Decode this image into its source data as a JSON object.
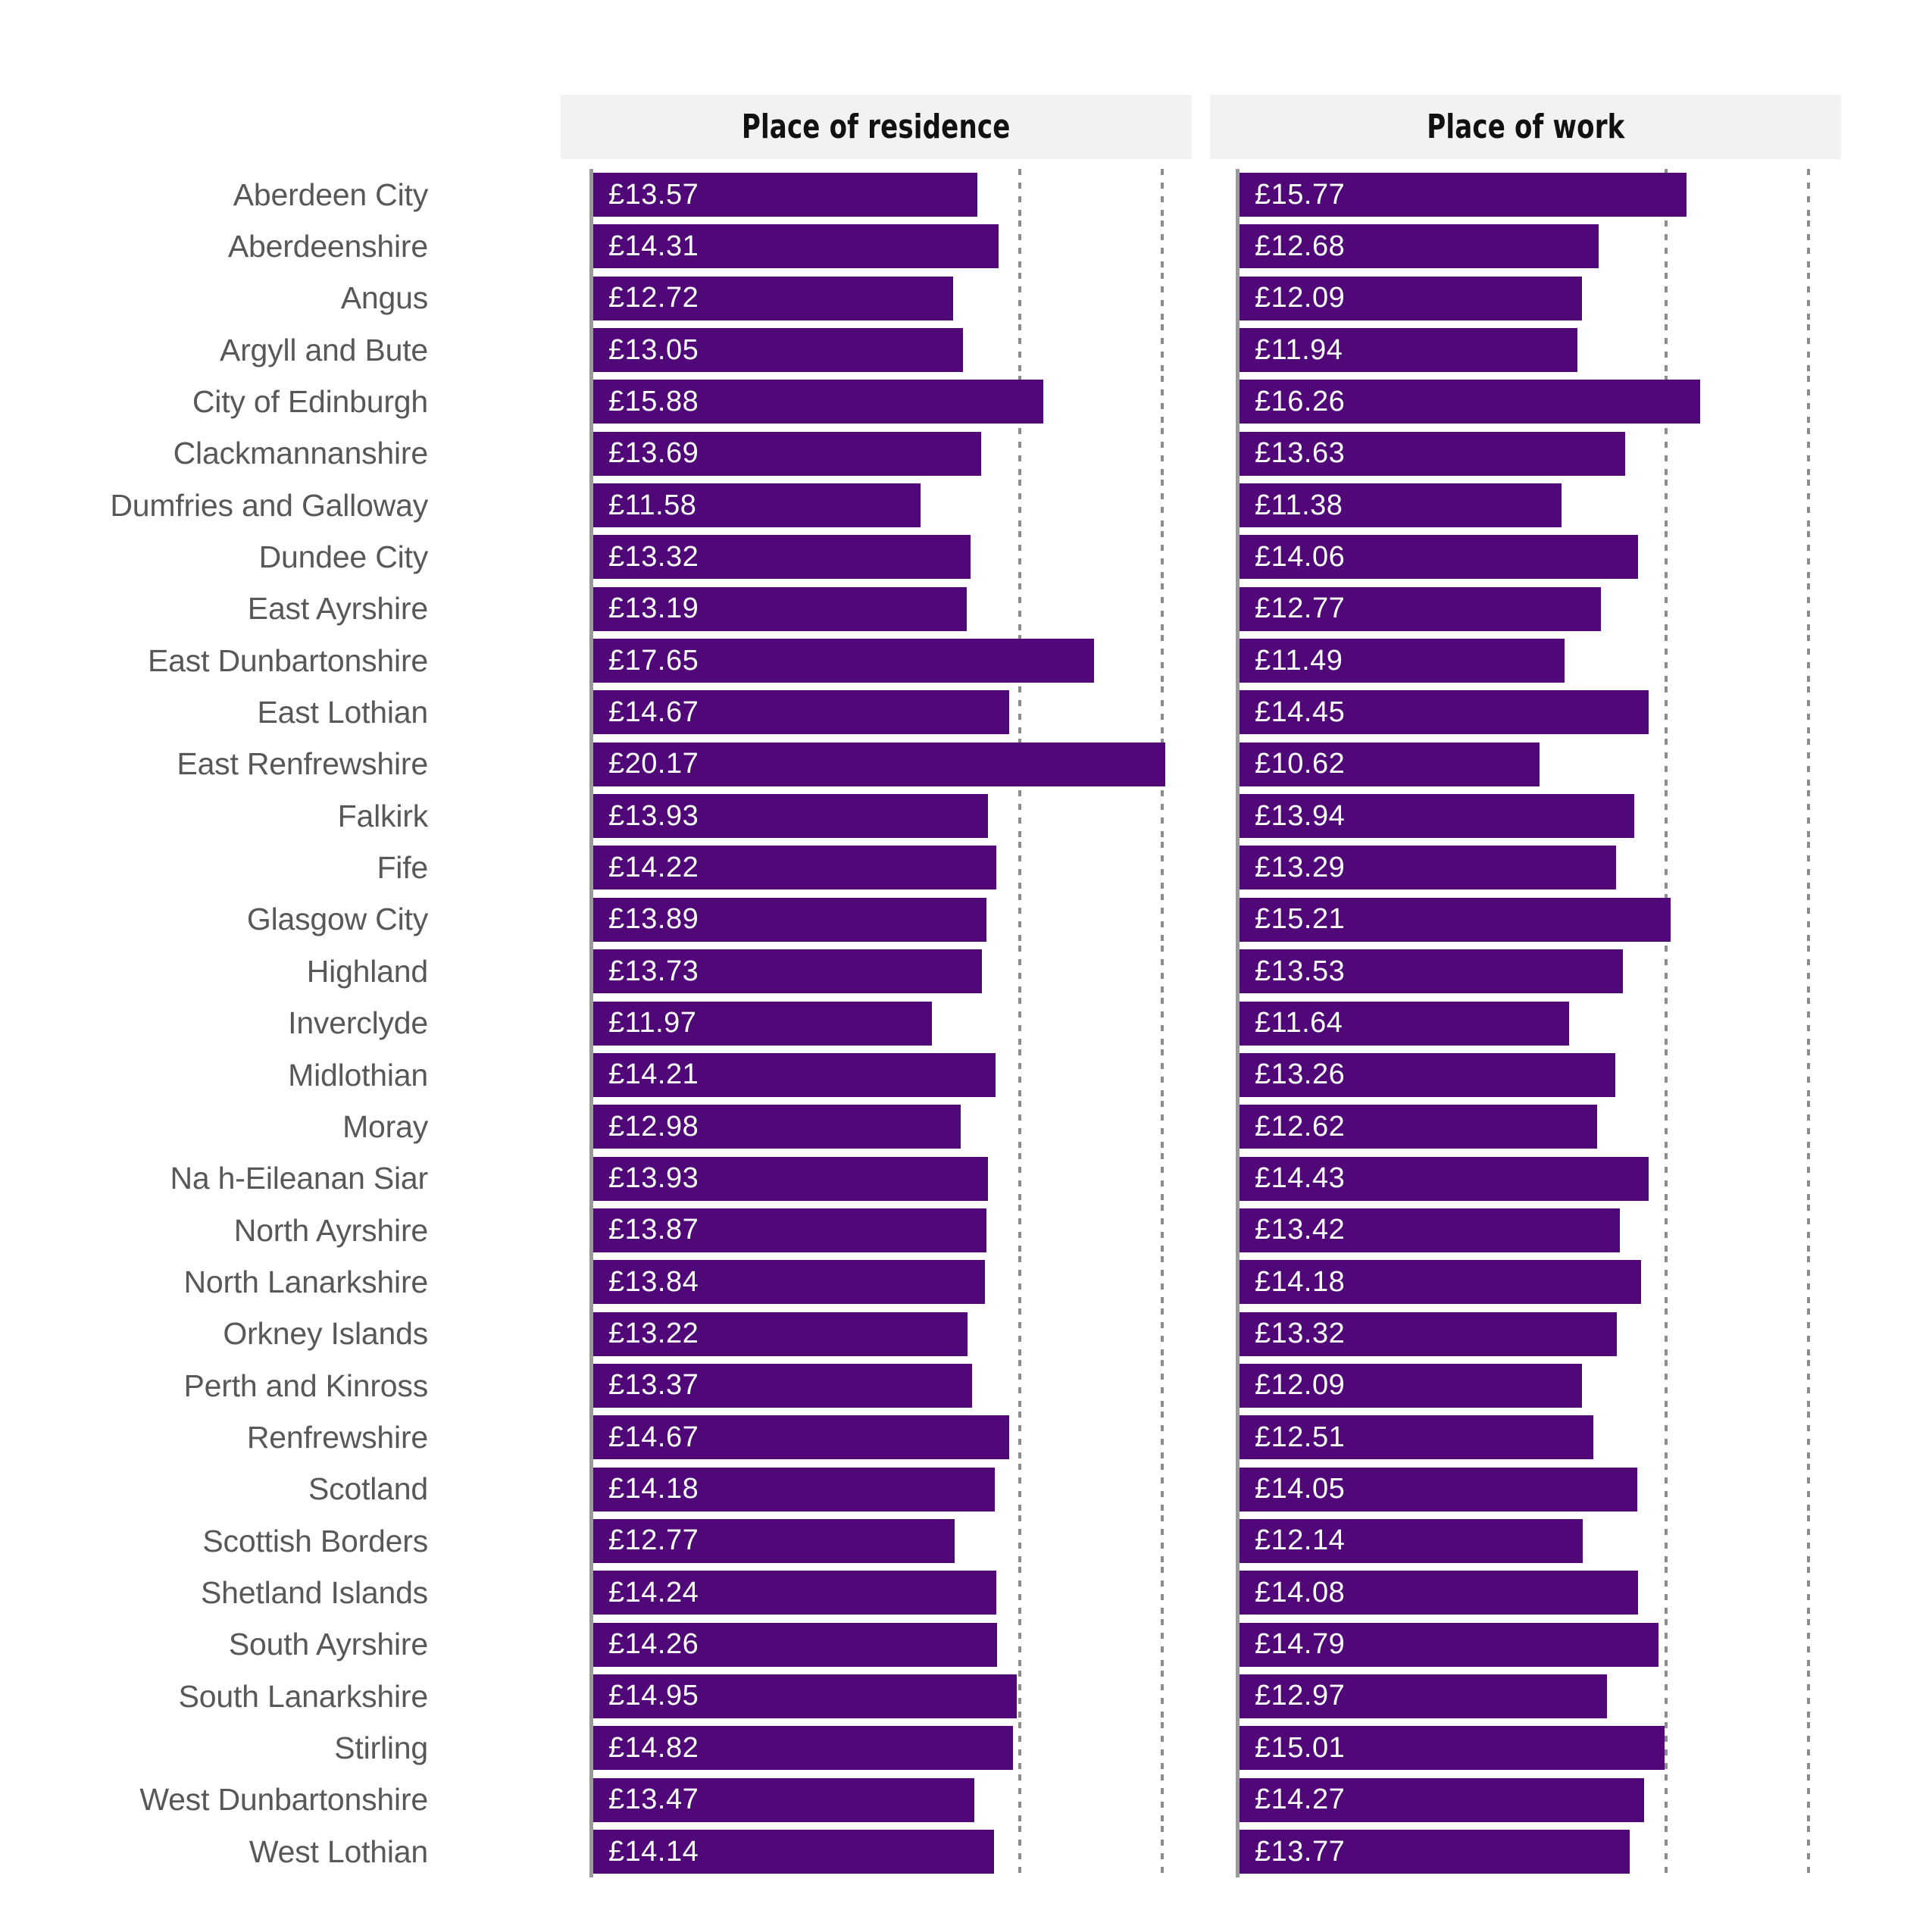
{
  "panels": [
    {
      "id": "residence",
      "title": "Place of residence"
    },
    {
      "id": "work",
      "title": "Place of work"
    }
  ],
  "colors": {
    "bar": "#500878",
    "header_band": "#f2f2f2",
    "label_text": "#58585b",
    "axis": "#9a9a9a",
    "grid": "#8c8c8c",
    "value_text": "#ffffff",
    "background": "#ffffff"
  },
  "chart_data": {
    "type": "bar",
    "title": "",
    "subtitle": "",
    "xlabel": "",
    "ylabel": "",
    "orientation": "horizontal",
    "grid": true,
    "grid_values": [
      15,
      20
    ],
    "legend": "none",
    "value_prefix": "£",
    "xlim": [
      0,
      22
    ],
    "categories": [
      "Aberdeen City",
      "Aberdeenshire",
      "Angus",
      "Argyll and Bute",
      "City of Edinburgh",
      "Clackmannanshire",
      "Dumfries and Galloway",
      "Dundee City",
      "East Ayrshire",
      "East Dunbartonshire",
      "East Lothian",
      "East Renfrewshire",
      "Falkirk",
      "Fife",
      "Glasgow City",
      "Highland",
      "Inverclyde",
      "Midlothian",
      "Moray",
      "Na h-Eileanan Siar",
      "North Ayrshire",
      "North Lanarkshire",
      "Orkney Islands",
      "Perth and Kinross",
      "Renfrewshire",
      "Scotland",
      "Scottish Borders",
      "Shetland Islands",
      "South Ayrshire",
      "South Lanarkshire",
      "Stirling",
      "West Dunbartonshire",
      "West Lothian"
    ],
    "series": [
      {
        "name": "Place of residence",
        "values": [
          13.57,
          14.31,
          12.72,
          13.05,
          15.88,
          13.69,
          11.58,
          13.32,
          13.19,
          17.65,
          14.67,
          20.17,
          13.93,
          14.22,
          13.89,
          13.73,
          11.97,
          14.21,
          12.98,
          13.93,
          13.87,
          13.84,
          13.22,
          13.37,
          14.67,
          14.18,
          12.77,
          14.24,
          14.26,
          14.95,
          14.82,
          13.47,
          14.14
        ],
        "labels": [
          "£13.57",
          "£14.31",
          "£12.72",
          "£13.05",
          "£15.88",
          "£13.69",
          "£11.58",
          "£13.32",
          "£13.19",
          "£17.65",
          "£14.67",
          "£20.17",
          "£13.93",
          "£14.22",
          "£13.89",
          "£13.73",
          "£11.97",
          "£14.21",
          "£12.98",
          "£13.93",
          "£13.87",
          "£13.84",
          "£13.22",
          "£13.37",
          "£14.67",
          "£14.18",
          "£12.77",
          "£14.24",
          "£14.26",
          "£14.95",
          "£14.82",
          "£13.47",
          "£14.14"
        ]
      },
      {
        "name": "Place of work",
        "values": [
          15.77,
          12.68,
          12.09,
          11.94,
          16.26,
          13.63,
          11.38,
          14.06,
          12.77,
          11.49,
          14.45,
          10.62,
          13.94,
          13.29,
          15.21,
          13.53,
          11.64,
          13.26,
          12.62,
          14.43,
          13.42,
          14.18,
          13.32,
          12.09,
          12.51,
          14.05,
          12.14,
          14.08,
          14.79,
          12.97,
          15.01,
          14.27,
          13.77
        ],
        "labels": [
          "£15.77",
          "£12.68",
          "£12.09",
          "£11.94",
          "£16.26",
          "£13.63",
          "£11.38",
          "£14.06",
          "£12.77",
          "£11.49",
          "£14.45",
          "£10.62",
          "£13.94",
          "£13.29",
          "£15.21",
          "£13.53",
          "£11.64",
          "£13.26",
          "£12.62",
          "£14.43",
          "£13.42",
          "£14.18",
          "£13.32",
          "£12.09",
          "£12.51",
          "£14.05",
          "£12.14",
          "£14.08",
          "£14.79",
          "£12.97",
          "£15.01",
          "£14.27",
          "£13.77"
        ]
      }
    ]
  }
}
